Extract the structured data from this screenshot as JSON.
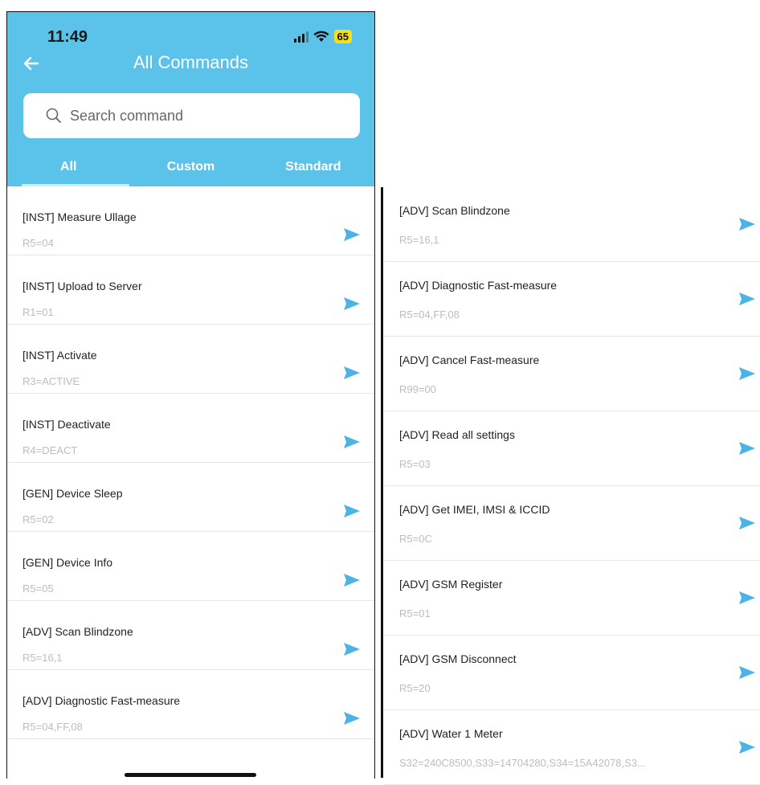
{
  "status_bar": {
    "time": "11:49",
    "battery": "65"
  },
  "header": {
    "title": "All Commands"
  },
  "search": {
    "placeholder": "Search command"
  },
  "tabs": [
    {
      "label": "All",
      "active": true
    },
    {
      "label": "Custom",
      "active": false
    },
    {
      "label": "Standard",
      "active": false
    }
  ],
  "left_list": [
    {
      "name": "[INST] Measure Ullage",
      "code": "R5=04"
    },
    {
      "name": "[INST] Upload to Server",
      "code": "R1=01"
    },
    {
      "name": "[INST] Activate",
      "code": "R3=ACTIVE"
    },
    {
      "name": "[INST] Deactivate",
      "code": "R4=DEACT"
    },
    {
      "name": "[GEN] Device Sleep",
      "code": "R5=02"
    },
    {
      "name": "[GEN] Device Info",
      "code": "R5=05"
    },
    {
      "name": "[ADV] Scan Blindzone",
      "code": "R5=16,1"
    },
    {
      "name": "[ADV] Diagnostic Fast-measure",
      "code": "R5=04,FF,08"
    }
  ],
  "right_list": [
    {
      "name": "[ADV] Scan Blindzone",
      "code": "R5=16,1"
    },
    {
      "name": "[ADV] Diagnostic Fast-measure",
      "code": "R5=04,FF,08"
    },
    {
      "name": "[ADV] Cancel Fast-measure",
      "code": "R99=00"
    },
    {
      "name": "[ADV] Read all settings",
      "code": "R5=03"
    },
    {
      "name": "[ADV] Get IMEI, IMSI & ICCID",
      "code": "R5=0C"
    },
    {
      "name": "[ADV] GSM Register",
      "code": "R5=01"
    },
    {
      "name": "[ADV] GSM Disconnect",
      "code": "R5=20"
    },
    {
      "name": "[ADV] Water 1 Meter",
      "code": "S32=240C8500,S33=14704280,S34=15A42078,S3..."
    }
  ],
  "colors": {
    "header": "#5bc3ea",
    "send_icon": "#4bb3e6"
  }
}
